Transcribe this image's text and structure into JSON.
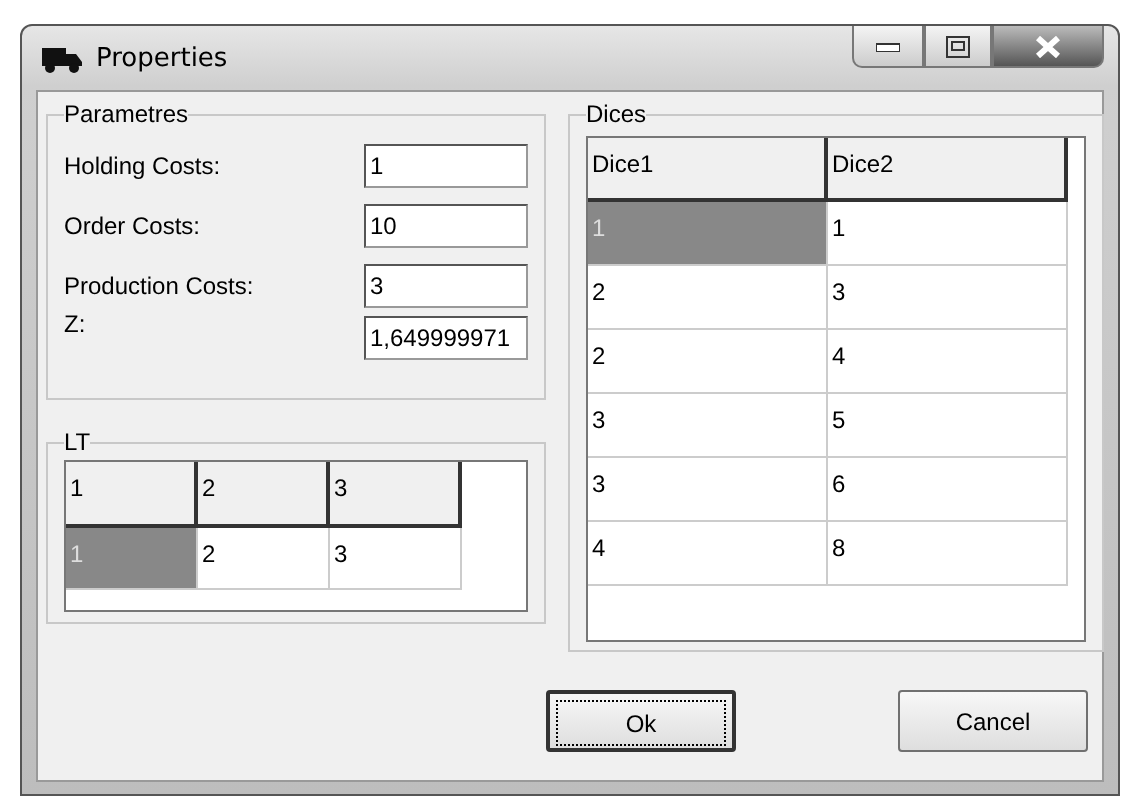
{
  "window": {
    "title": "Properties"
  },
  "parameters": {
    "title": "Parametres",
    "fields": [
      {
        "label": "Holding Costs:",
        "value": "1"
      },
      {
        "label": "Order Costs:",
        "value": "10"
      },
      {
        "label": "Production Costs:",
        "value": "3"
      },
      {
        "label": "Z:",
        "value": "1,649999971"
      }
    ]
  },
  "lt": {
    "title": "LT",
    "columns": [
      "1",
      "2",
      "3"
    ],
    "rows": [
      [
        {
          "text": "1",
          "selected": true
        },
        {
          "text": "2",
          "selected": false
        },
        {
          "text": "3",
          "selected": false
        }
      ]
    ]
  },
  "dices": {
    "title": "Dices",
    "columns": [
      "Dice1",
      "Dice2"
    ],
    "rows": [
      [
        {
          "text": "1",
          "selected": true
        },
        {
          "text": "1",
          "selected": false
        }
      ],
      [
        {
          "text": "2",
          "selected": false
        },
        {
          "text": "3",
          "selected": false
        }
      ],
      [
        {
          "text": "2",
          "selected": false
        },
        {
          "text": "4",
          "selected": false
        }
      ],
      [
        {
          "text": "3",
          "selected": false
        },
        {
          "text": "5",
          "selected": false
        }
      ],
      [
        {
          "text": "3",
          "selected": false
        },
        {
          "text": "6",
          "selected": false
        }
      ],
      [
        {
          "text": "4",
          "selected": false
        },
        {
          "text": "8",
          "selected": false
        }
      ]
    ]
  },
  "buttons": [
    {
      "label": "Ok",
      "default": true
    },
    {
      "label": "Cancel",
      "default": false
    }
  ]
}
